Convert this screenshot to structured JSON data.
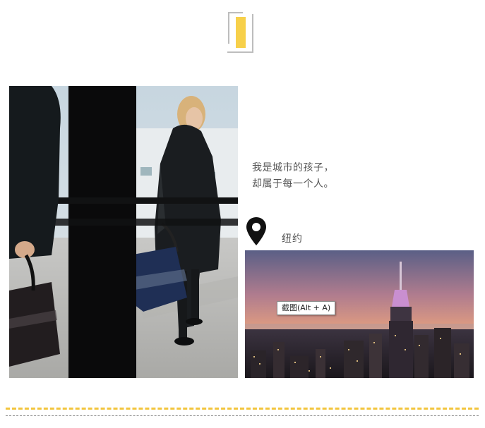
{
  "intro": {
    "line1": "我是城市的孩子，",
    "line2": "却属于每一个人。"
  },
  "location": {
    "label": "纽约",
    "icon": "map-pin-icon"
  },
  "tooltip": {
    "text": "截图(Alt + A)"
  },
  "decoration": {
    "icon": "bracket-icon",
    "accent_color": "#f7d04a"
  },
  "photos": {
    "left": "woman-with-bag-photo",
    "right": "new-york-skyline-photo"
  },
  "dividers": {
    "primary_color": "#f2c53d",
    "secondary_color": "#9a9a9a"
  }
}
